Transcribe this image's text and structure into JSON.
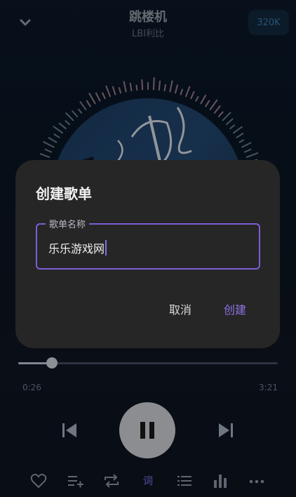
{
  "header": {
    "song_title": "跳楼机",
    "artist": "LBI利比",
    "quality": "320K"
  },
  "dialog": {
    "title": "创建歌单",
    "field_label": "歌单名称",
    "field_value": "乐乐游戏网",
    "cancel_label": "取消",
    "create_label": "创建"
  },
  "player": {
    "elapsed": "0:26",
    "duration": "3:21",
    "progress_fraction": 0.13
  },
  "toolbar": {
    "lyrics_label": "词"
  },
  "icons": [
    "chevron-down-icon",
    "previous-icon",
    "pause-icon",
    "next-icon",
    "heart-icon",
    "add-to-playlist-icon",
    "repeat-icon",
    "playlist-icon",
    "equalizer-icon",
    "more-icon"
  ],
  "colors": {
    "accent": "#8f72e6",
    "dialog_bg": "#262626",
    "quality_text": "#3f7cb0"
  }
}
